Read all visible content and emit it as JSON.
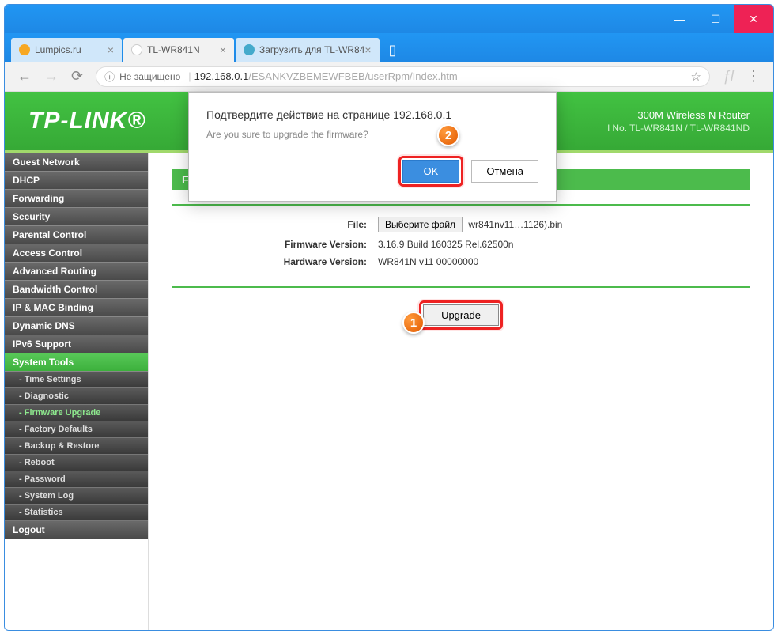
{
  "window": {
    "minimize": "—",
    "maximize": "☐",
    "close": "✕"
  },
  "tabs": [
    {
      "title": "Lumpics.ru",
      "favicon": "#f7a823"
    },
    {
      "title": "TL-WR841N",
      "favicon": "#fff"
    },
    {
      "title": "Загрузить для TL-WR84",
      "favicon": "#4ac"
    }
  ],
  "address": {
    "secure_label": "Не защищено",
    "host": "192.168.0.1",
    "path": "/ESANKVZBEMEWFBEB/userRpm/Index.htm"
  },
  "header": {
    "logo": "TP-LINK®",
    "product": "300M Wireless N Router",
    "model": "l No. TL-WR841N / TL-WR841ND"
  },
  "sidebar": {
    "items": [
      "Guest Network",
      "DHCP",
      "Forwarding",
      "Security",
      "Parental Control",
      "Access Control",
      "Advanced Routing",
      "Bandwidth Control",
      "IP & MAC Binding",
      "Dynamic DNS",
      "IPv6 Support"
    ],
    "active": "System Tools",
    "subs": [
      "- Time Settings",
      "- Diagnostic",
      "- Firmware Upgrade",
      "- Factory Defaults",
      "- Backup & Restore",
      "- Reboot",
      "- Password",
      "- System Log",
      "- Statistics"
    ],
    "logout": "Logout"
  },
  "content": {
    "title": "Firmware Upgrade",
    "file_label": "File:",
    "choose_file": "Выберите файл",
    "file_name": "wr841nv11…1126).bin",
    "fw_label": "Firmware Version:",
    "fw_value": "3.16.9 Build 160325 Rel.62500n",
    "hw_label": "Hardware Version:",
    "hw_value": "WR841N v11 00000000",
    "upgrade": "Upgrade"
  },
  "dialog": {
    "title": "Подтвердите действие на странице 192.168.0.1",
    "text": "Are you sure to upgrade the firmware?",
    "ok": "OK",
    "cancel": "Отмена"
  },
  "badges": {
    "one": "1",
    "two": "2"
  }
}
